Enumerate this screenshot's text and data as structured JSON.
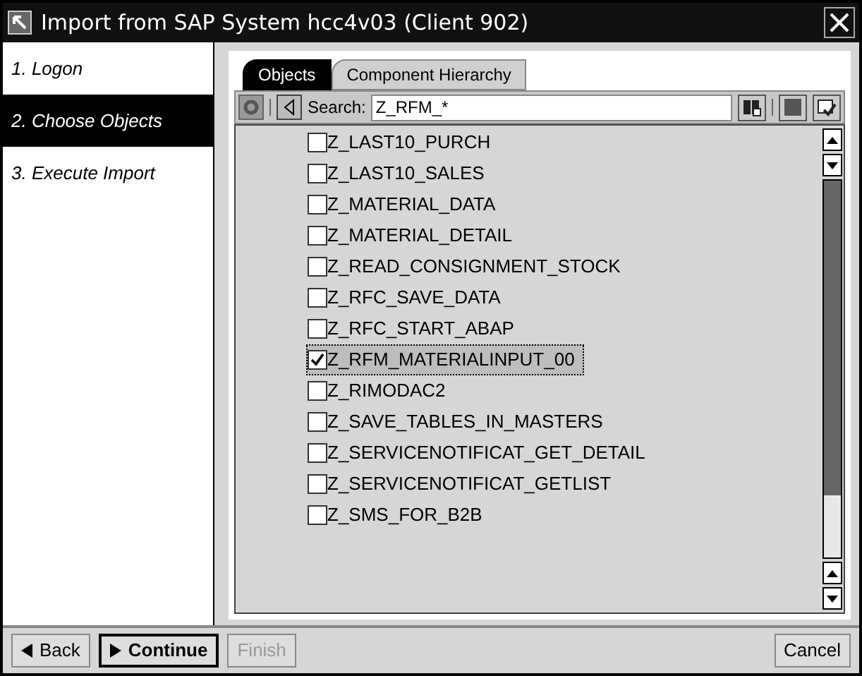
{
  "window": {
    "title": "Import from SAP System hcc4v03 (Client 902)"
  },
  "steps": [
    {
      "label": "1. Logon",
      "selected": false
    },
    {
      "label": "2. Choose Objects",
      "selected": true
    },
    {
      "label": "3. Execute Import",
      "selected": false
    }
  ],
  "tabs": [
    {
      "label": "Objects",
      "selected": true
    },
    {
      "label": "Component Hierarchy",
      "selected": false
    }
  ],
  "search": {
    "label": "Search:",
    "value": "Z_RFM_*"
  },
  "objects": [
    {
      "name": "Z_LAST10_PURCH",
      "checked": false,
      "selected": false
    },
    {
      "name": "Z_LAST10_SALES",
      "checked": false,
      "selected": false
    },
    {
      "name": "Z_MATERIAL_DATA",
      "checked": false,
      "selected": false
    },
    {
      "name": "Z_MATERIAL_DETAIL",
      "checked": false,
      "selected": false
    },
    {
      "name": "Z_READ_CONSIGNMENT_STOCK",
      "checked": false,
      "selected": false
    },
    {
      "name": "Z_RFC_SAVE_DATA",
      "checked": false,
      "selected": false
    },
    {
      "name": "Z_RFC_START_ABAP",
      "checked": false,
      "selected": false
    },
    {
      "name": "Z_RFM_MATERIALINPUT_00",
      "checked": true,
      "selected": true
    },
    {
      "name": "Z_RIMODAC2",
      "checked": false,
      "selected": false
    },
    {
      "name": "Z_SAVE_TABLES_IN_MASTERS",
      "checked": false,
      "selected": false
    },
    {
      "name": "Z_SERVICENOTIFICAT_GET_DETAIL",
      "checked": false,
      "selected": false
    },
    {
      "name": "Z_SERVICENOTIFICAT_GETLIST",
      "checked": false,
      "selected": false
    },
    {
      "name": "Z_SMS_FOR_B2B",
      "checked": false,
      "selected": false
    }
  ],
  "buttons": [
    {
      "label": "Back",
      "kind": "back",
      "disabled": false,
      "default": false
    },
    {
      "label": "Continue",
      "kind": "next",
      "disabled": false,
      "default": true
    },
    {
      "label": "Finish",
      "kind": "plain",
      "disabled": true,
      "default": false
    }
  ],
  "cancel": {
    "label": "Cancel"
  }
}
